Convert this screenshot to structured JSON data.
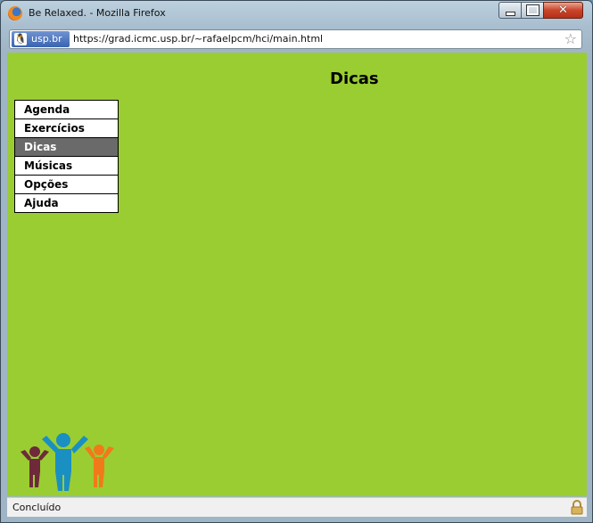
{
  "window": {
    "title": "Be Relaxed. - Mozilla Firefox",
    "buttons": {
      "minimize": "minimize-icon",
      "maximize": "maximize-icon",
      "close": "close-icon"
    }
  },
  "urlbar": {
    "site_identity": "usp.br",
    "url": "https://grad.icmc.usp.br/~rafaelpcm/hci/main.html",
    "bookmark_icon": "star-icon"
  },
  "page": {
    "heading": "Dicas",
    "menu": [
      {
        "label": "Agenda",
        "active": false
      },
      {
        "label": "Exercícios",
        "active": false
      },
      {
        "label": "Dicas",
        "active": true
      },
      {
        "label": "Músicas",
        "active": false
      },
      {
        "label": "Opções",
        "active": false
      },
      {
        "label": "Ajuda",
        "active": false
      }
    ],
    "colors": {
      "background": "#9acd32",
      "menu_active_bg": "#6a6a6a",
      "menu_bg": "#ffffff"
    }
  },
  "status": {
    "text": "Concluído",
    "secure_icon": "lock-icon"
  }
}
